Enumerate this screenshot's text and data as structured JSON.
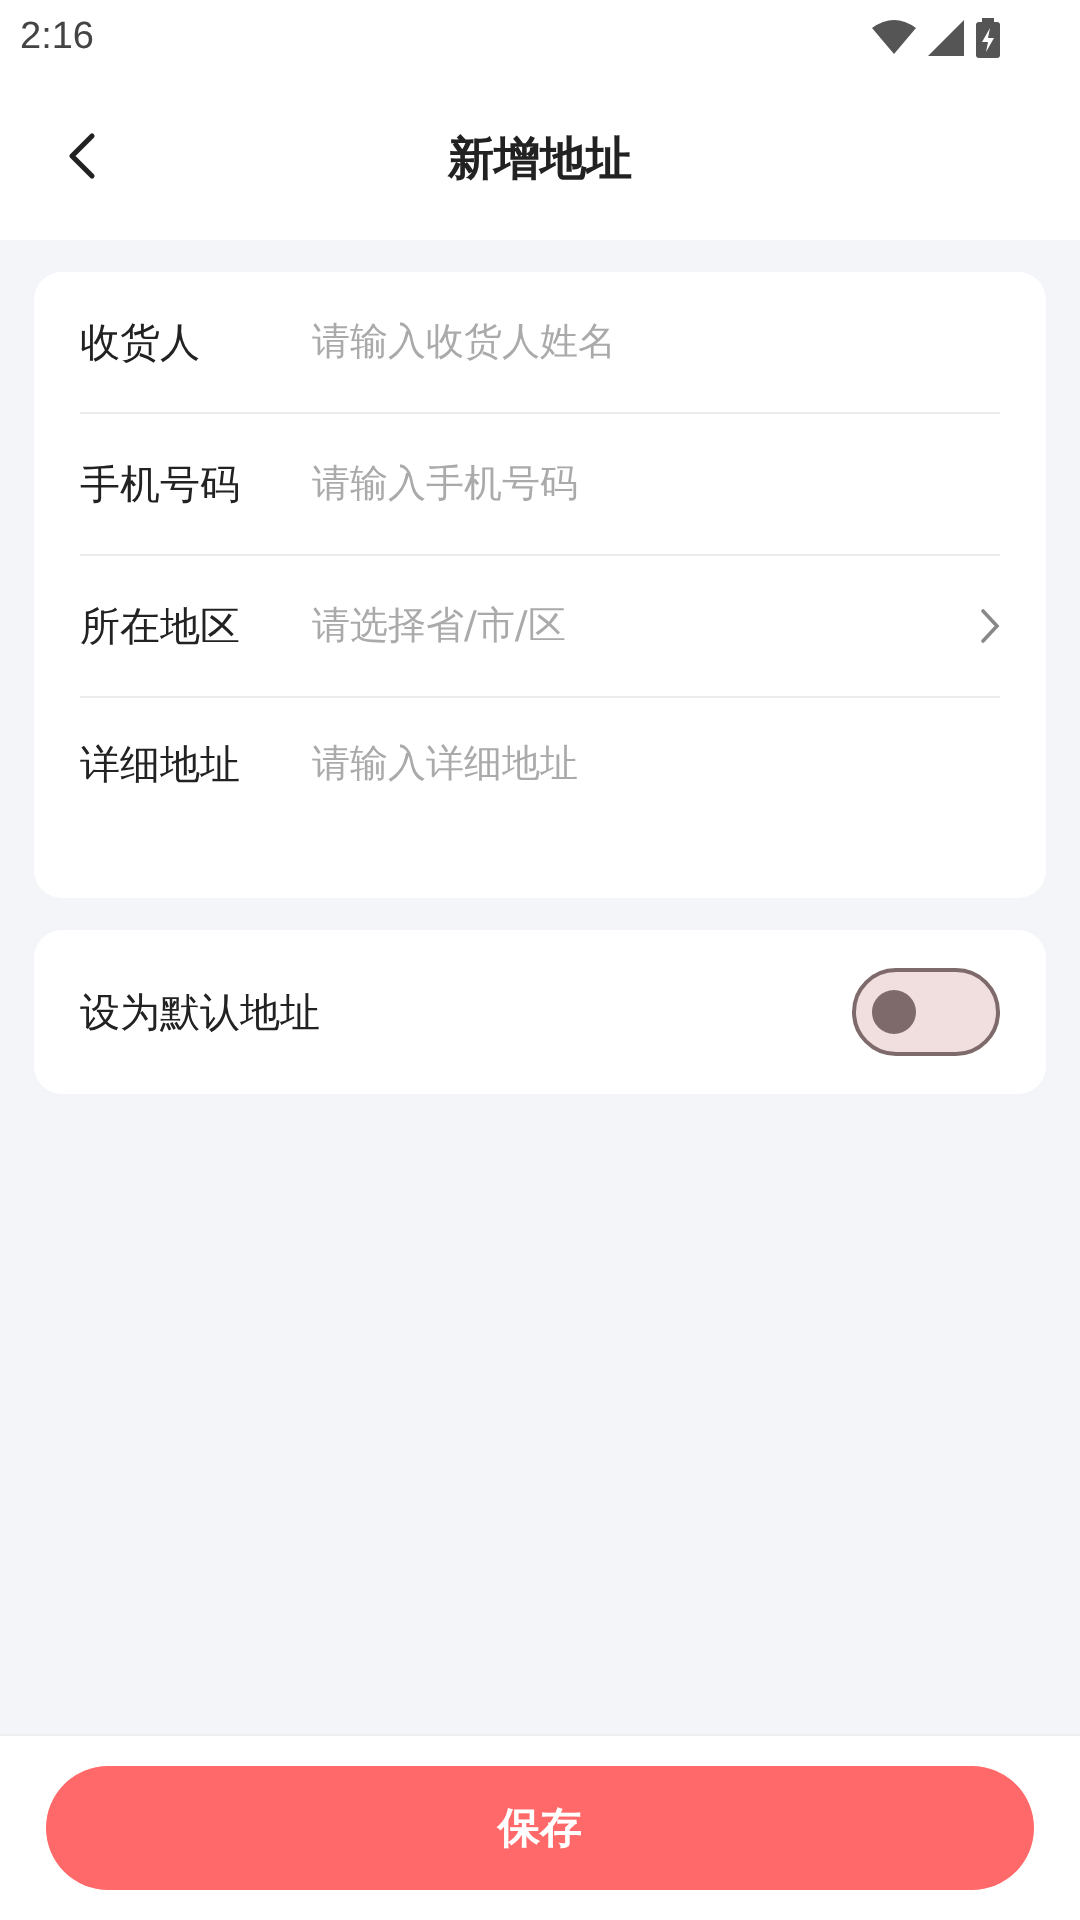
{
  "status_bar": {
    "time": "2:16"
  },
  "header": {
    "title": "新增地址"
  },
  "form": {
    "fields": [
      {
        "kind": "input",
        "label": "收货人",
        "placeholder": "请输入收货人姓名"
      },
      {
        "kind": "input",
        "label": "手机号码",
        "placeholder": "请输入手机号码"
      },
      {
        "kind": "select",
        "label": "所在地区",
        "placeholder": "请选择省/市/区"
      },
      {
        "kind": "textarea",
        "label": "详细地址",
        "placeholder": "请输入详细地址"
      }
    ]
  },
  "default_address": {
    "label": "设为默认地址",
    "on": false
  },
  "save_button": {
    "label": "保存"
  }
}
